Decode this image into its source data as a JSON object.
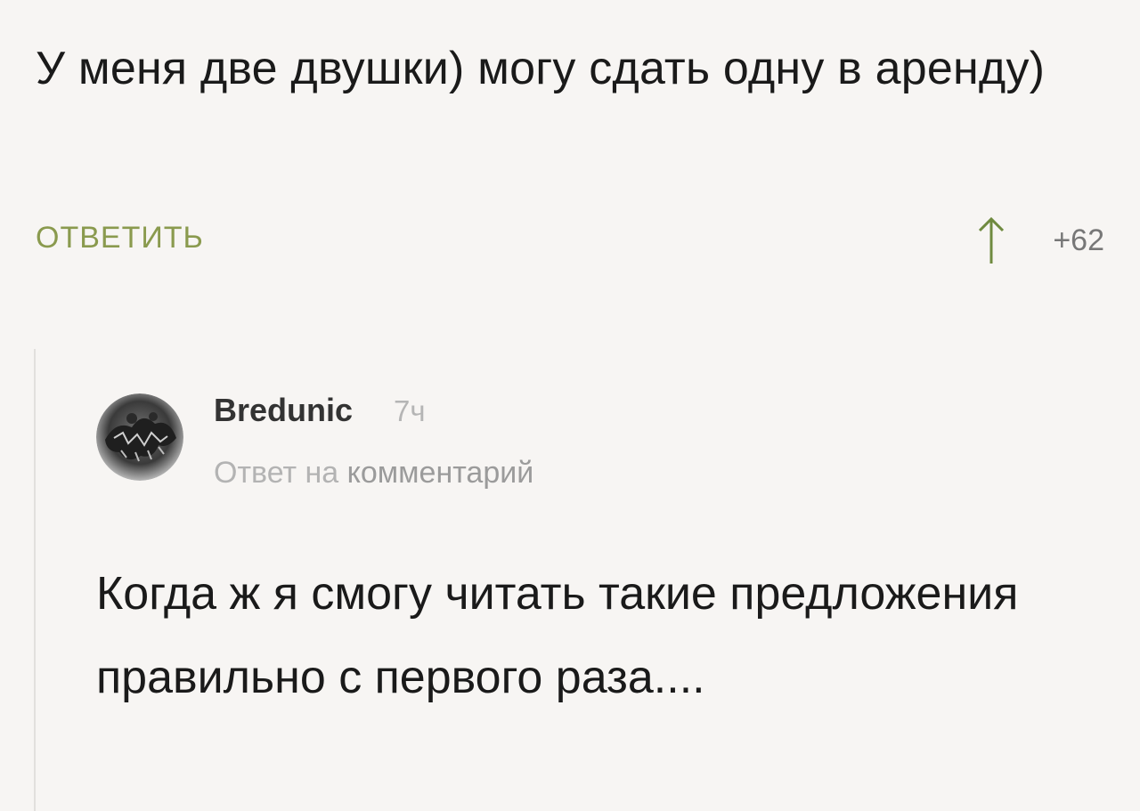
{
  "parent_comment": {
    "text": "У меня две двушки) могу сдать одну в аренду)",
    "reply_label": "ОТВЕТИТЬ",
    "upvote_icon": "arrow-up-icon",
    "rating": "+62"
  },
  "reply_comment": {
    "author": "Bredunic",
    "time": "7ч",
    "reply_prefix": "Ответ на",
    "reply_target": "комментарий",
    "text": "Когда ж я смогу читать такие предложения правильно с первого раза...."
  },
  "colors": {
    "reply_link": "#8a9a4e",
    "text": "#1a1a1a",
    "muted": "#b3b3b3",
    "background": "#f7f5f3"
  }
}
